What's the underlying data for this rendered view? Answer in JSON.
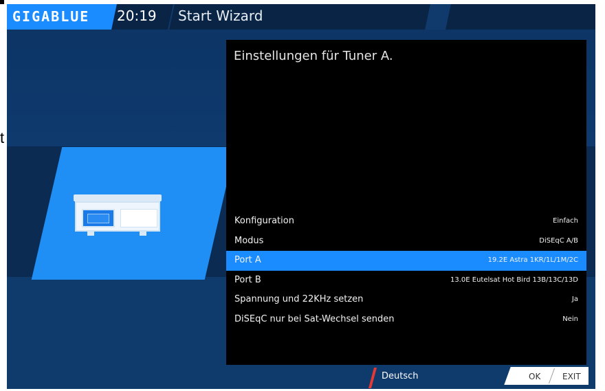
{
  "header": {
    "logo": "GIGABLUE",
    "time": "20:19",
    "title": "Start Wizard"
  },
  "artifacts": {
    "left_glyph": "t"
  },
  "panel": {
    "title": "Einstellungen für Tuner A.",
    "rows": [
      {
        "label": "Konfiguration",
        "value": "Einfach"
      },
      {
        "label": "Modus",
        "value": "DiSEqC A/B"
      },
      {
        "label": "Port A",
        "value": "19.2E Astra 1KR/1L/1M/2C"
      },
      {
        "label": "Port B",
        "value": "13.0E Eutelsat Hot Bird 13B/13C/13D"
      },
      {
        "label": "Spannung und 22KHz setzen",
        "value": "Ja"
      },
      {
        "label": "DiSEqC nur bei Sat-Wechsel senden",
        "value": "Nein"
      }
    ],
    "selected_index": 2
  },
  "footer": {
    "language": "Deutsch",
    "ok_label": "OK",
    "exit_label": "EXIT"
  },
  "colors": {
    "accent": "#1a8cff",
    "background": "#0f3a6b",
    "panel": "#000000",
    "language_marker": "#e53935"
  },
  "icons": {
    "hero": "satellite-receiver-icon"
  }
}
